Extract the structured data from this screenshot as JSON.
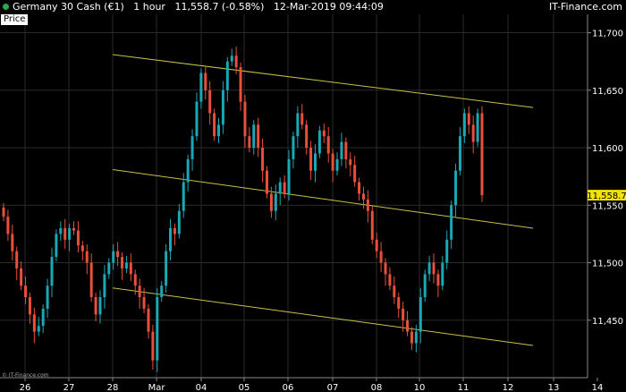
{
  "header": {
    "instrument": "Germany 30 Cash (€1)",
    "timeframe": "1 hour",
    "last_change": "11,558.7 (-0.58%)",
    "datetime": "12-Mar-2019 09:44:09",
    "brand": "IT-Finance.com",
    "status_dot_color": "#2aa84a"
  },
  "panel_label": "Price",
  "current_price_label": "11,558.7",
  "copyright": "© IT-Finance.com",
  "colors": {
    "up": "#1aa8b4",
    "down": "#e8503c",
    "channel": "#c8c24a",
    "grid": "#2a2a2a",
    "price_tag": "#f2e200"
  },
  "chart_data": {
    "type": "candlestick",
    "x_ticks": [
      "26",
      "27",
      "28",
      "Mar",
      "04",
      "05",
      "06",
      "07",
      "08",
      "10",
      "11",
      "12",
      "13",
      "14"
    ],
    "y_ticks": [
      "11,700",
      "11,650",
      "11,600",
      "11,550",
      "11,500",
      "11,450"
    ],
    "y_tick_values": [
      11700,
      11650,
      11600,
      11550,
      11500,
      11450
    ],
    "ylim": [
      11400,
      11716
    ],
    "current_price": 11558.7,
    "channel_lines": [
      {
        "start": [
          "26+2.0",
          11681
        ],
        "end": [
          "12+0.55",
          11635
        ]
      },
      {
        "start": [
          "26+2.0",
          11581
        ],
        "end": [
          "12+0.55",
          11530
        ]
      },
      {
        "start": [
          "26+2.0",
          11478
        ],
        "end": [
          "12+0.55",
          11428
        ]
      }
    ],
    "closes": [
      11540,
      11525,
      11510,
      11495,
      11480,
      11470,
      11455,
      11440,
      11445,
      11460,
      11480,
      11505,
      11525,
      11530,
      11520,
      11530,
      11528,
      11515,
      11510,
      11500,
      11470,
      11455,
      11470,
      11490,
      11500,
      11510,
      11505,
      11495,
      11500,
      11490,
      11480,
      11470,
      11460,
      11440,
      11415,
      11470,
      11480,
      11510,
      11530,
      11525,
      11545,
      11570,
      11590,
      11610,
      11640,
      11665,
      11650,
      11630,
      11610,
      11620,
      11650,
      11675,
      11680,
      11670,
      11640,
      11610,
      11600,
      11620,
      11600,
      11580,
      11560,
      11545,
      11560,
      11570,
      11560,
      11590,
      11610,
      11630,
      11620,
      11600,
      11580,
      11595,
      11615,
      11610,
      11595,
      11580,
      11590,
      11605,
      11590,
      11585,
      11570,
      11560,
      11555,
      11545,
      11520,
      11510,
      11500,
      11490,
      11480,
      11470,
      11460,
      11450,
      11440,
      11430,
      11440,
      11470,
      11490,
      11500,
      11490,
      11480,
      11500,
      11520,
      11550,
      11580,
      11610,
      11630,
      11620,
      11605,
      11630,
      11558.7
    ]
  }
}
